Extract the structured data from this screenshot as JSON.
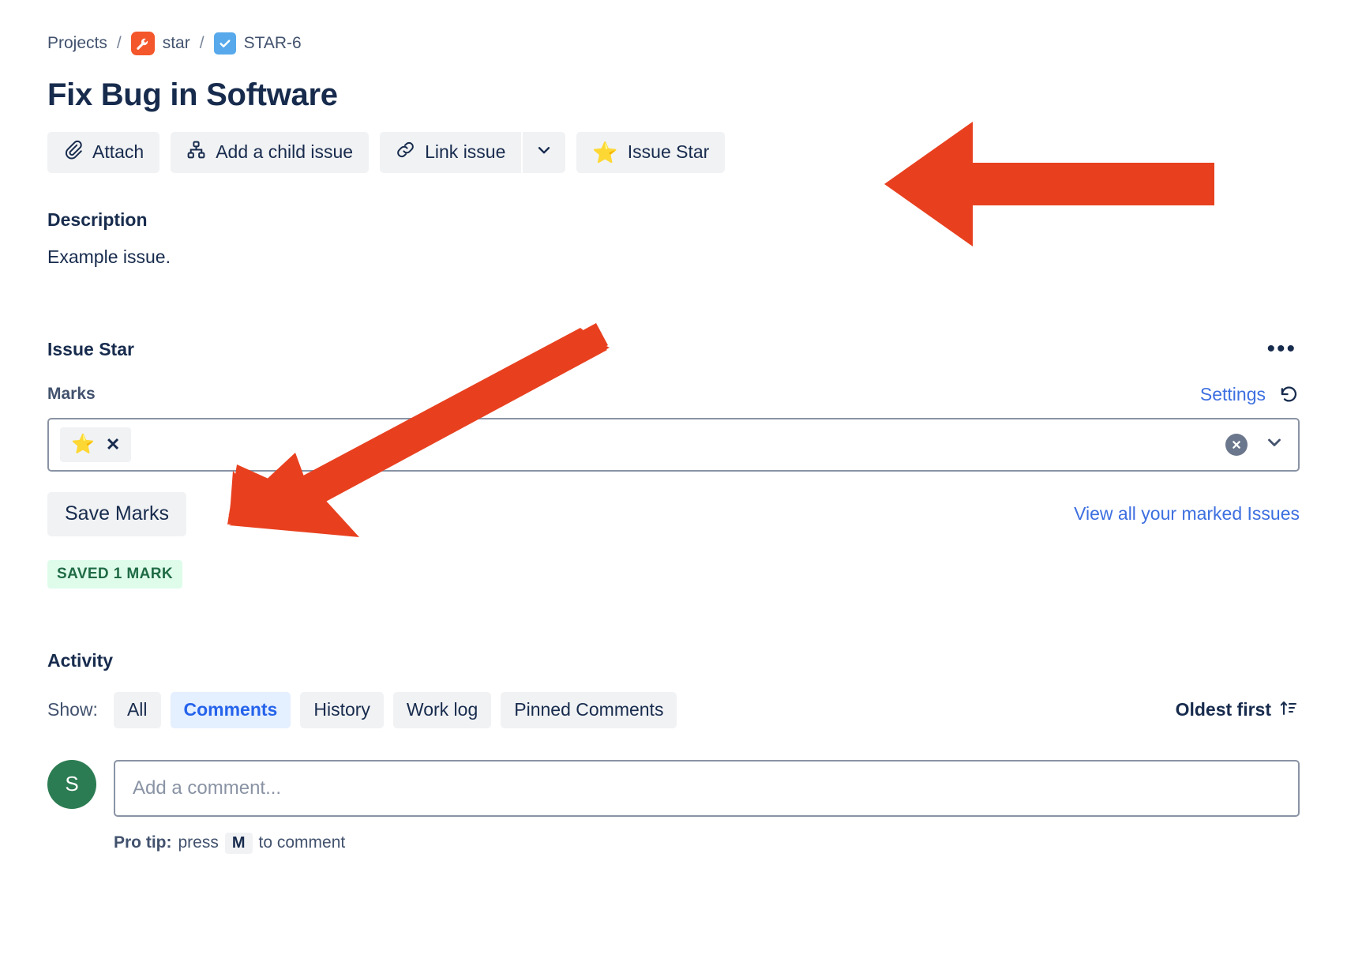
{
  "breadcrumb": {
    "projects_label": "Projects",
    "separator": "/",
    "project_name": "star",
    "issue_key": "STAR-6",
    "project_icon": "wrench-icon",
    "issue_type_icon": "task-check-icon"
  },
  "issue": {
    "title": "Fix Bug in Software"
  },
  "toolbar": {
    "attach_label": "Attach",
    "attach_icon": "paperclip-icon",
    "child_issue_label": "Add a child issue",
    "child_issue_icon": "hierarchy-icon",
    "link_issue_label": "Link issue",
    "link_issue_icon": "chain-link-icon",
    "link_caret_icon": "chevron-down-icon",
    "issue_star_label": "Issue Star",
    "issue_star_icon": "star-emoji"
  },
  "description": {
    "heading": "Description",
    "body": "Example issue."
  },
  "issue_star_panel": {
    "title": "Issue Star",
    "more_label": "•••",
    "more_icon": "more-horizontal-icon",
    "marks_label": "Marks",
    "settings_label": "Settings",
    "refresh_icon": "refresh-counterclockwise-icon",
    "selected_marks": [
      {
        "emoji": "⭐",
        "name": "star-mark",
        "remove_label": "✕"
      }
    ],
    "clear_icon": "clear-circle-icon",
    "dropdown_icon": "chevron-down-icon",
    "save_label": "Save Marks",
    "view_all_label": "View all your marked Issues",
    "saved_badge": "SAVED 1 MARK",
    "saved_badge_bg": "#DFFCEB",
    "saved_badge_color": "#1F6B45"
  },
  "activity": {
    "heading": "Activity",
    "show_label": "Show:",
    "filters": [
      {
        "label": "All",
        "active": false
      },
      {
        "label": "Comments",
        "active": true
      },
      {
        "label": "History",
        "active": false
      },
      {
        "label": "Work log",
        "active": false
      },
      {
        "label": "Pinned Comments",
        "active": false
      }
    ],
    "sort_label": "Oldest first",
    "sort_icon": "sort-ascending-icon",
    "avatar_initial": "S",
    "avatar_color": "#2C7C53",
    "comment_placeholder": "Add a comment...",
    "protip_prefix": "Pro tip:",
    "protip_mid": "press",
    "protip_key": "M",
    "protip_suffix": "to comment"
  },
  "annotations": {
    "arrow_color": "#E8401F",
    "arrow_1_target": "issue-star-button",
    "arrow_2_target": "marks-select-field"
  }
}
